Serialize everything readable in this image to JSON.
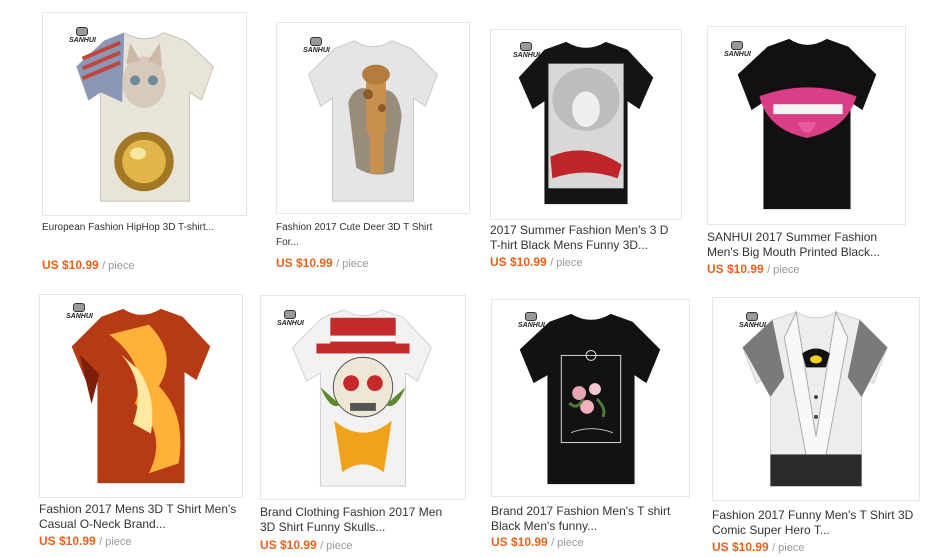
{
  "brand_mark": "SANHUI",
  "products": [
    {
      "title": "European Fashion HipHop 3D T-shirt...",
      "price": "US $10.99",
      "unit": "/ piece",
      "print": "astronaut-cat"
    },
    {
      "title": "Fashion 2017 Cute Deer 3D T Shirt For...",
      "price": "US $10.99",
      "unit": "/ piece",
      "print": "giraffe"
    },
    {
      "title": "2017 Summer Fashion Men's 3 D T-hirt Black Mens Funny 3D...",
      "price": "US $10.99",
      "unit": "/ piece",
      "print": "black-veil-brides"
    },
    {
      "title": "SANHUI 2017 Summer Fashion Men's Big Mouth Printed Black...",
      "price": "US $10.99",
      "unit": "/ piece",
      "print": "pink-lips"
    },
    {
      "title": "Fashion 2017 Mens 3D T Shirt Men's Casual O-Neck Brand...",
      "price": "US $10.99",
      "unit": "/ piece",
      "print": "fire"
    },
    {
      "title": "Brand Clothing Fashion 2017 Men 3D Shirt Funny Skulls...",
      "price": "US $10.99",
      "unit": "/ piece",
      "print": "top-hat-skull"
    },
    {
      "title": "Brand 2017 Fashion Men's T shirt Black Men's funny...",
      "price": "US $10.99",
      "unit": "/ piece",
      "print": "chainsmokers-roses"
    },
    {
      "title": "Fashion 2017 Funny Men's T Shirt 3D Comic Super Hero T...",
      "price": "US $10.99",
      "unit": "/ piece",
      "print": "tuxedo-bat"
    }
  ],
  "colors": {
    "price": "#e8611c",
    "unit": "#999999",
    "title": "#333333"
  }
}
